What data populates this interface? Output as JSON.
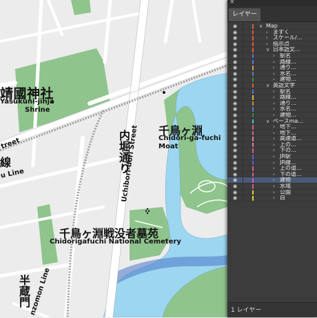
{
  "map": {
    "labels": {
      "shrine_jp": "靖國神社",
      "shrine_en_line1": "Yasukuni-jinja",
      "shrine_en_line2": "Shrine",
      "moat_jp": "千鳥ヶ淵",
      "moat_en_line1": "Chidori-ga-fuchi",
      "moat_en_line2": "Moat",
      "street_jp": "内堀通り",
      "street_en": "Uchibori-dori Street",
      "cemetery_jp": "千鳥ヶ淵戦没者墓苑",
      "cemetery_en": "Chidorigafuchi National Cemetery",
      "left_street_fragment": "treet",
      "left_line_jp": "線",
      "left_line_en": "u Line",
      "hanzomon_jp": "半蔵門",
      "hanzomon_en": "nzomon Line"
    },
    "colors": {
      "background": "#ececec",
      "road": "#ffffff",
      "park": "#8fc48d",
      "water": "#9dd6f0",
      "rail": "#9a9a9a"
    }
  },
  "panel": {
    "close_glyph": "×",
    "tab_label": "レイヤー",
    "footer": "1 レイヤー",
    "rows": [
      {
        "name": "Map",
        "depth": 0,
        "twirl": "∨",
        "color": "#e05a3a"
      },
      {
        "name": "ますく",
        "depth": 1,
        "twirl": "›",
        "color": "#e05a3a"
      },
      {
        "name": "スケール/…",
        "depth": 1,
        "twirl": "›",
        "color": "#e05a3a"
      },
      {
        "name": "指示点",
        "depth": 1,
        "twirl": "›",
        "color": "#e05a3a"
      },
      {
        "name": "日本語文…",
        "depth": 1,
        "twirl": "∨",
        "color": "#e05a3a"
      },
      {
        "name": "駅名",
        "depth": 2,
        "twirl": "›",
        "color": "#5a78d6"
      },
      {
        "name": "路線…",
        "depth": 2,
        "twirl": "›",
        "color": "#5a78d6"
      },
      {
        "name": "通り…",
        "depth": 2,
        "twirl": "›",
        "color": "#c8a040"
      },
      {
        "name": "水名…",
        "depth": 2,
        "twirl": "›",
        "color": "#5a78d6"
      },
      {
        "name": "建物…",
        "depth": 2,
        "twirl": "›",
        "color": "#3a8a3a"
      },
      {
        "name": "英語文字",
        "depth": 1,
        "twirl": "∨",
        "color": "#e05a3a"
      },
      {
        "name": "駅名",
        "depth": 2,
        "twirl": "›",
        "color": "#5a78d6"
      },
      {
        "name": "路線…",
        "depth": 2,
        "twirl": "›",
        "color": "#d0c040"
      },
      {
        "name": "通り…",
        "depth": 2,
        "twirl": "›",
        "color": "#e08a30"
      },
      {
        "name": "水名…",
        "depth": 2,
        "twirl": "›",
        "color": "#5a78d6"
      },
      {
        "name": "建物…",
        "depth": 2,
        "twirl": "›",
        "color": "#3a8a3a"
      },
      {
        "name": "ベースma…",
        "depth": 1,
        "twirl": "∨",
        "color": "#40c8e0"
      },
      {
        "name": "地下…",
        "depth": 2,
        "twirl": "›",
        "color": "#d06080"
      },
      {
        "name": "地下…",
        "depth": 2,
        "twirl": "›",
        "color": "#d06080"
      },
      {
        "name": "高速道…",
        "depth": 2,
        "twirl": "›",
        "color": "#e08090"
      },
      {
        "name": "上の…",
        "depth": 2,
        "twirl": "›",
        "color": "#e08090"
      },
      {
        "name": "下の…",
        "depth": 2,
        "twirl": "›",
        "color": "#d06080"
      },
      {
        "name": "JR駅",
        "depth": 2,
        "twirl": "›",
        "color": "#6a5ad0"
      },
      {
        "name": "JR線…",
        "depth": 2,
        "twirl": "›",
        "color": "#6a5ad0"
      },
      {
        "name": "上の道…",
        "depth": 2,
        "twirl": "›",
        "color": "#d06080"
      },
      {
        "name": "下の道…",
        "depth": 2,
        "twirl": "›",
        "color": "#d06080"
      },
      {
        "name": "建物",
        "depth": 2,
        "twirl": "›",
        "color": "#c060d0",
        "selected": true
      },
      {
        "name": "水域",
        "depth": 2,
        "twirl": "›",
        "color": "#d06080"
      },
      {
        "name": "公園",
        "depth": 2,
        "twirl": "›",
        "color": "#e0d040"
      },
      {
        "name": "白",
        "depth": 2,
        "twirl": "›",
        "color": "#e0d040"
      }
    ]
  }
}
